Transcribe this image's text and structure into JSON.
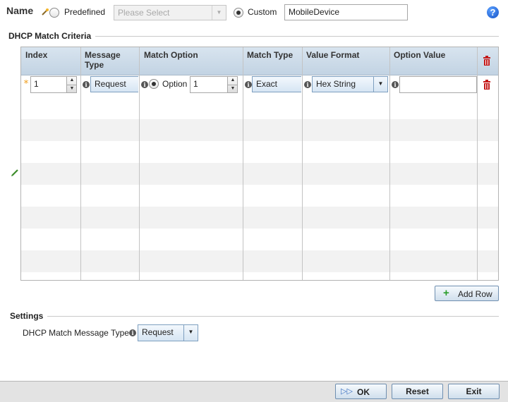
{
  "name_row": {
    "label": "Name",
    "predefined_label": "Predefined",
    "predefined_placeholder": "Please Select",
    "custom_label": "Custom",
    "custom_value": "MobileDevice",
    "help_glyph": "?"
  },
  "criteria": {
    "title": "DHCP Match Criteria",
    "columns": [
      "Index",
      "Message Type",
      "Match Option",
      "Match Type",
      "Value Format",
      "Option Value"
    ],
    "rows": [
      {
        "index": "1",
        "message_type": "Request",
        "match_option_label": "Option",
        "match_option_value": "1",
        "match_type": "Exact",
        "value_format": "Hex String",
        "option_value": ""
      }
    ],
    "add_row_label": "Add Row"
  },
  "settings": {
    "title": "Settings",
    "message_type_label": "DHCP Match Message Type",
    "message_type_value": "Request"
  },
  "footer": {
    "ok_label": "OK",
    "reset_label": "Reset",
    "exit_label": "Exit"
  },
  "icons": {
    "required": "asterisk-icon",
    "edit": "pencil-icon",
    "delete": "trash-icon",
    "info": "info-icon",
    "wand": "wand-icon"
  },
  "colors": {
    "required_star": "#f0a020",
    "delete_icon": "#c41a1a",
    "add_plus": "#2a9d2a",
    "help": "#1552c6"
  }
}
